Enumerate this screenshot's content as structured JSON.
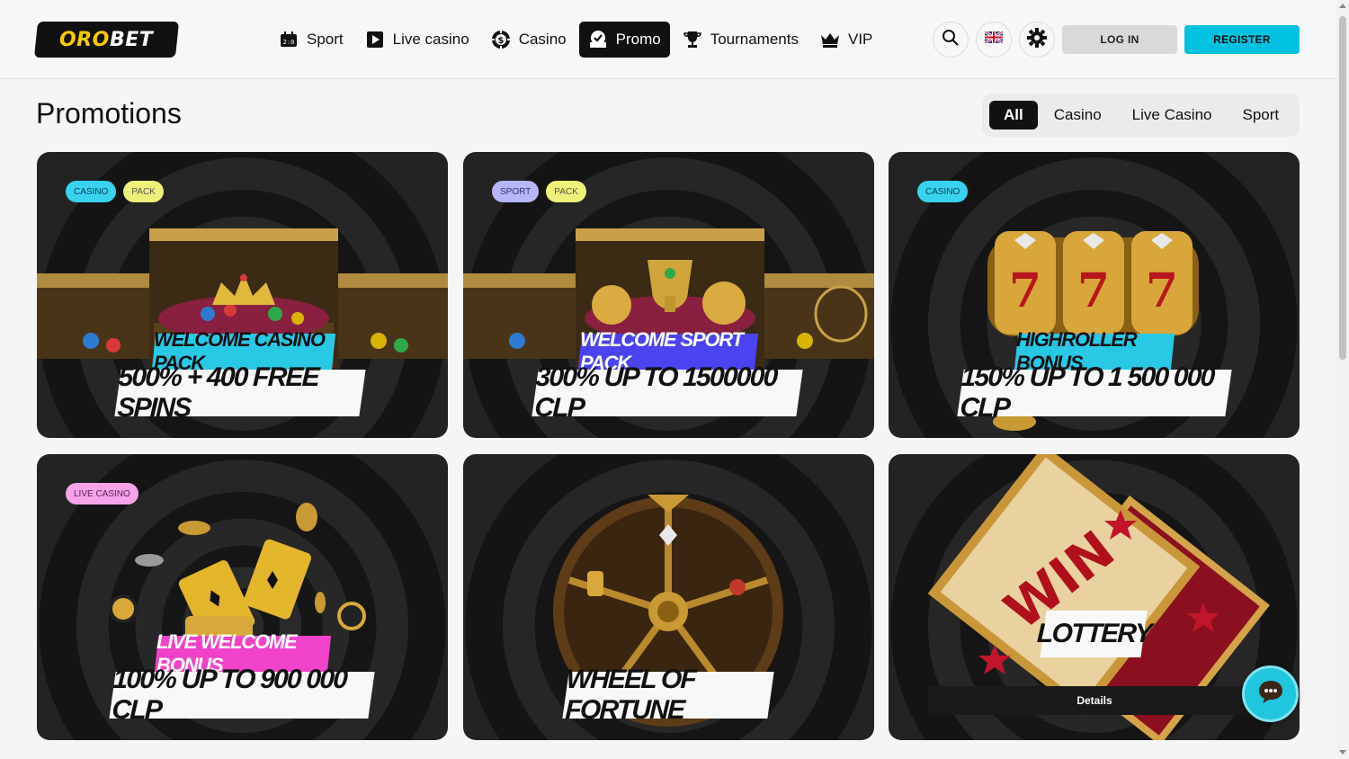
{
  "header": {
    "logo": {
      "part1": "ORO",
      "part2": "BET"
    },
    "nav": [
      {
        "label": "Sport",
        "icon": "scoreboard-icon"
      },
      {
        "label": "Live casino",
        "icon": "play-icon"
      },
      {
        "label": "Casino",
        "icon": "casino-chip-icon"
      },
      {
        "label": "Promo",
        "icon": "gift-icon",
        "active": true
      },
      {
        "label": "Tournaments",
        "icon": "trophy-icon"
      },
      {
        "label": "VIP",
        "icon": "crown-icon"
      }
    ],
    "login_label": "LOG IN",
    "register_label": "REGISTER"
  },
  "page": {
    "title": "Promotions",
    "filters": [
      {
        "label": "All",
        "active": true
      },
      {
        "label": "Casino"
      },
      {
        "label": "Live Casino"
      },
      {
        "label": "Sport"
      }
    ]
  },
  "promos": [
    {
      "tags": [
        "CASINO",
        "PACK"
      ],
      "top_label": "WELCOME CASINO PACK",
      "main_label": "500% + 400 FREE SPINS",
      "top_color": "#29c9e6"
    },
    {
      "tags": [
        "SPORT",
        "PACK"
      ],
      "top_label": "WELCOME SPORT PACK",
      "main_label": "300% UP TO 1500000 CLP",
      "top_color": "#4b43f0"
    },
    {
      "tags": [
        "CASINO"
      ],
      "top_label": "HIGHROLLER BONUS",
      "main_label": "150% UP TO 1 500 000 CLP",
      "top_color": "#29c9e6"
    },
    {
      "tags": [
        "LIVE CASINO"
      ],
      "top_label": "LIVE WELCOME BONUS",
      "main_label": "100% UP TO 900 000 CLP",
      "top_color": "#f043c9"
    },
    {
      "tags": [],
      "top_label": "",
      "main_label": "WHEEL OF FORTUNE",
      "top_color": ""
    },
    {
      "tags": [],
      "top_label": "",
      "main_label": "LOTTERY",
      "top_color": "",
      "details_label": "Details"
    }
  ],
  "colors": {
    "accent": "#00c2e0",
    "logo_yellow": "#f7c900",
    "dark": "#111111"
  }
}
